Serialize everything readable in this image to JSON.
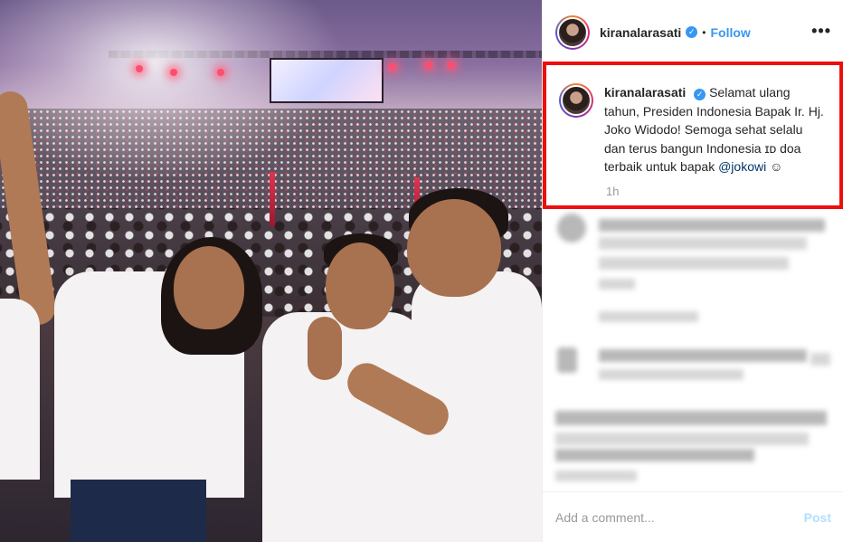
{
  "post": {
    "username": "kiranalarasati",
    "verified_badge": "✓",
    "separator": "•",
    "follow_label": "Follow",
    "more_icon": "•••"
  },
  "caption": {
    "username": "kiranalarasati",
    "text_before_mention": "Selamat ulang tahun, Presiden Indonesia Bapak Ir. Hj. Joko Widodo! Semoga sehat selalu dan terus bangun Indonesia ɪᴅ doa terbaik untuk bapak ",
    "mention": "@jokowi",
    "text_after_mention": " ☺",
    "timestamp": "1h"
  },
  "comment_bar": {
    "placeholder": "Add a comment...",
    "post_label": "Post"
  },
  "colors": {
    "highlight_border": "#ee0d0d",
    "follow_blue": "#3897f0",
    "post_disabled": "#b2dffc"
  }
}
